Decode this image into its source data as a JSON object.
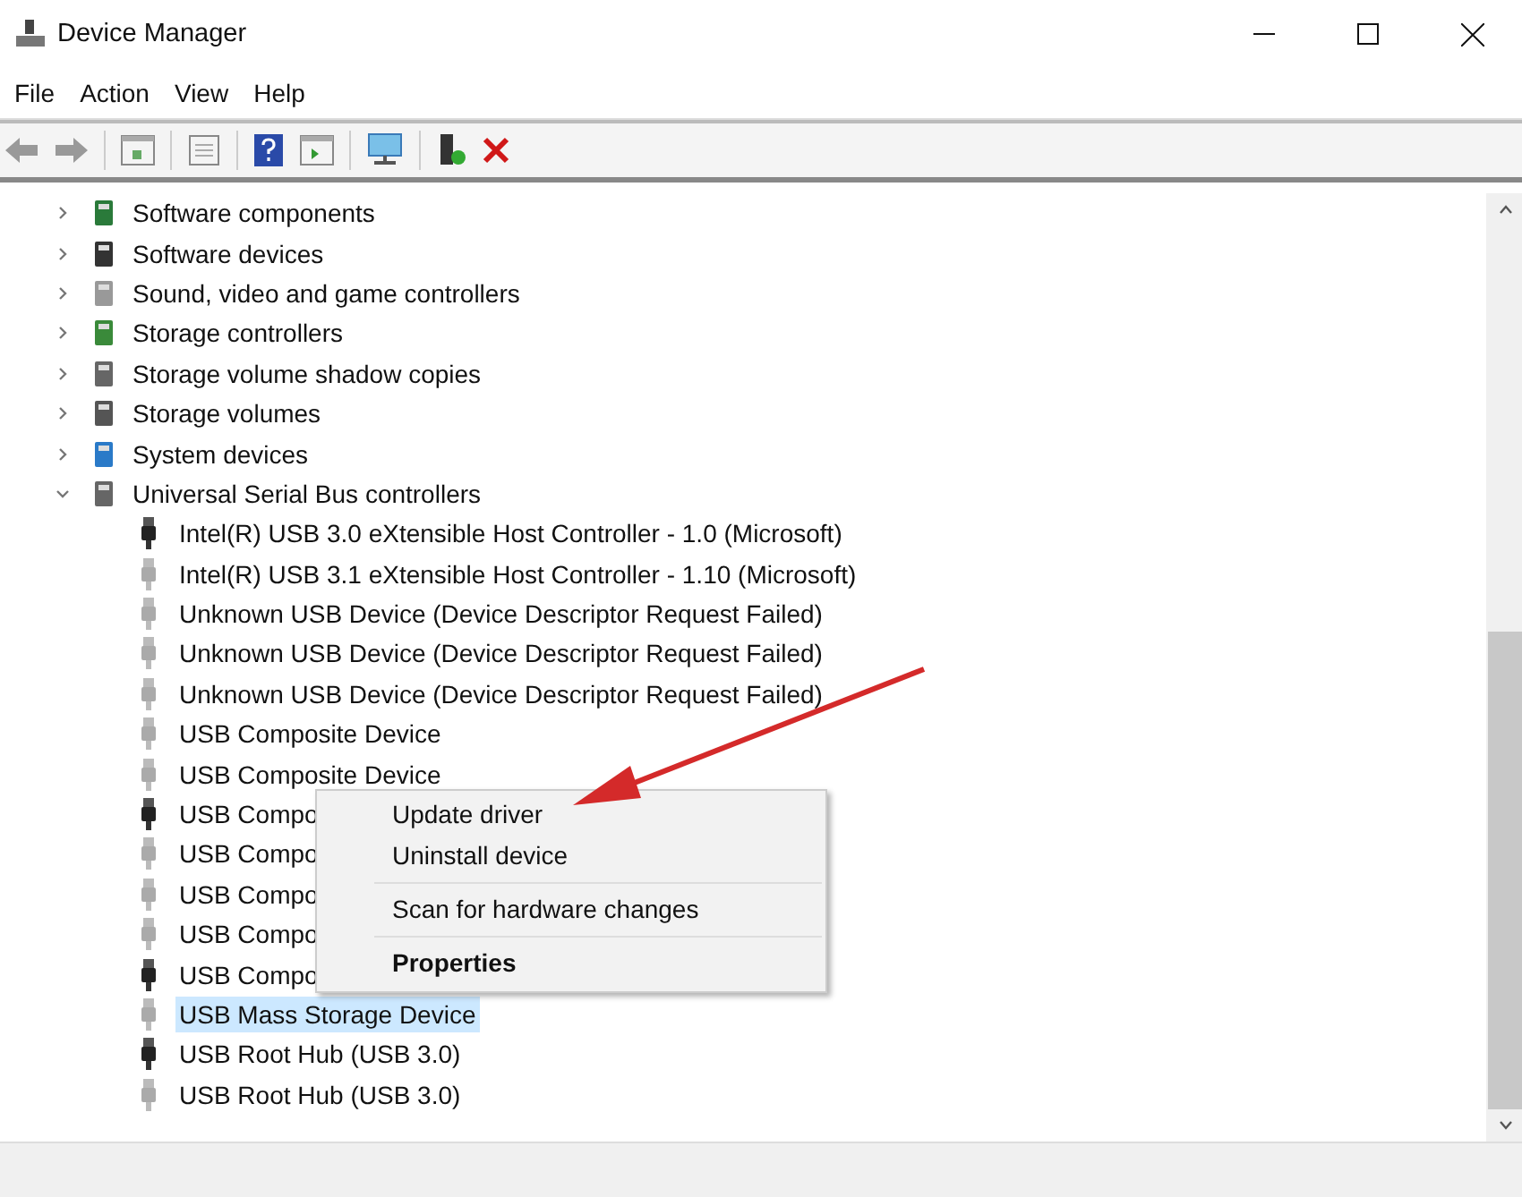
{
  "window": {
    "title": "Device Manager"
  },
  "menu": [
    "File",
    "Action",
    "View",
    "Help"
  ],
  "tree": [
    {
      "label": "Software components",
      "expanded": false
    },
    {
      "label": "Software devices",
      "expanded": false
    },
    {
      "label": "Sound, video and game controllers",
      "expanded": false
    },
    {
      "label": "Storage controllers",
      "expanded": false
    },
    {
      "label": "Storage volume shadow copies",
      "expanded": false
    },
    {
      "label": "Storage volumes",
      "expanded": false
    },
    {
      "label": "System devices",
      "expanded": false
    },
    {
      "label": "Universal Serial Bus controllers",
      "expanded": true,
      "children": [
        {
          "label": "Intel(R) USB 3.0 eXtensible Host Controller - 1.0 (Microsoft)",
          "kind": "dark",
          "selected": false
        },
        {
          "label": "Intel(R) USB 3.1 eXtensible Host Controller - 1.10 (Microsoft)",
          "kind": "light",
          "selected": false
        },
        {
          "label": "Unknown USB Device (Device Descriptor Request Failed)",
          "kind": "light",
          "selected": false
        },
        {
          "label": "Unknown USB Device (Device Descriptor Request Failed)",
          "kind": "light",
          "selected": false
        },
        {
          "label": "Unknown USB Device (Device Descriptor Request Failed)",
          "kind": "light",
          "selected": false
        },
        {
          "label": "USB Composite Device",
          "kind": "light",
          "selected": false
        },
        {
          "label": "USB Composite Device",
          "kind": "light",
          "selected": false
        },
        {
          "label": "USB Compo",
          "kind": "dark",
          "selected": false
        },
        {
          "label": "USB Compo",
          "kind": "light",
          "selected": false
        },
        {
          "label": "USB Compo",
          "kind": "light",
          "selected": false
        },
        {
          "label": "USB Compo",
          "kind": "light",
          "selected": false
        },
        {
          "label": "USB Compo",
          "kind": "dark",
          "selected": false
        },
        {
          "label": "USB Mass Storage Device",
          "kind": "light",
          "selected": true
        },
        {
          "label": "USB Root Hub (USB 3.0)",
          "kind": "dark",
          "selected": false
        },
        {
          "label": "USB Root Hub (USB 3.0)",
          "kind": "light",
          "selected": false
        }
      ]
    }
  ],
  "context_menu": [
    {
      "label": "Update driver",
      "bold": false
    },
    {
      "label": "Uninstall device",
      "bold": false
    },
    {
      "kind": "separator"
    },
    {
      "label": "Scan for hardware changes",
      "bold": false
    },
    {
      "kind": "separator"
    },
    {
      "label": "Properties",
      "bold": true
    }
  ]
}
